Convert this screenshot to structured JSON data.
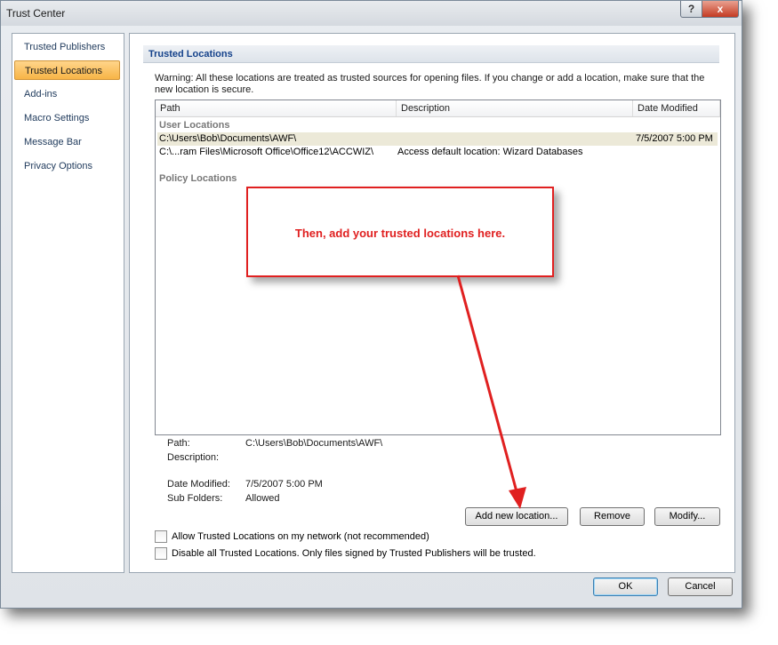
{
  "window": {
    "title": "Trust Center",
    "help_glyph": "?",
    "close_glyph": "x"
  },
  "sidebar": {
    "items": [
      {
        "label": "Trusted Publishers"
      },
      {
        "label": "Trusted Locations",
        "active": true
      },
      {
        "label": "Add-ins"
      },
      {
        "label": "Macro Settings"
      },
      {
        "label": "Message Bar"
      },
      {
        "label": "Privacy Options"
      }
    ]
  },
  "main": {
    "section_title": "Trusted Locations",
    "warning": "Warning: All these locations are treated as trusted sources for opening files.  If you change or add a location, make sure that the new location is secure.",
    "columns": [
      "Path",
      "Description",
      "Date Modified"
    ],
    "groups": {
      "user": "User Locations",
      "policy": "Policy Locations"
    },
    "rows": [
      {
        "path": "C:\\Users\\Bob\\Documents\\AWF\\",
        "description": "",
        "date": "7/5/2007 5:00 PM",
        "selected": true
      },
      {
        "path": "C:\\...ram Files\\Microsoft Office\\Office12\\ACCWIZ\\",
        "description": "Access default location: Wizard Databases",
        "date": ""
      }
    ],
    "details": {
      "path_label": "Path:",
      "path_value": "C:\\Users\\Bob\\Documents\\AWF\\",
      "description_label": "Description:",
      "description_value": "",
      "date_label": "Date Modified:",
      "date_value": "7/5/2007 5:00 PM",
      "subfolders_label": "Sub Folders:",
      "subfolders_value": "Allowed"
    },
    "buttons": {
      "add": "Add new location...",
      "remove": "Remove",
      "modify": "Modify..."
    },
    "checkboxes": {
      "allow_network": "Allow Trusted Locations on my network (not recommended)",
      "disable_all": "Disable all Trusted Locations. Only files signed by Trusted Publishers will be trusted."
    }
  },
  "footer": {
    "ok": "OK",
    "cancel": "Cancel"
  },
  "annotation": {
    "text": "Then, add your trusted locations here.",
    "color": "#e02020"
  }
}
